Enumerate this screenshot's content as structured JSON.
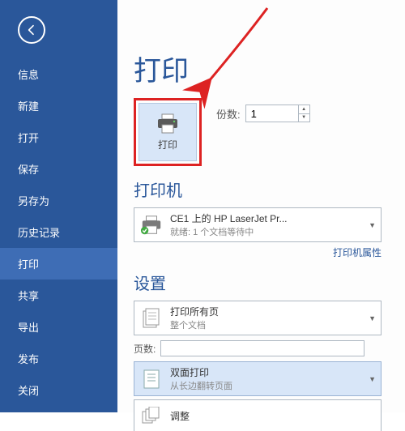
{
  "sidebar": {
    "items": [
      {
        "label": "信息"
      },
      {
        "label": "新建"
      },
      {
        "label": "打开"
      },
      {
        "label": "保存"
      },
      {
        "label": "另存为"
      },
      {
        "label": "历史记录"
      },
      {
        "label": "打印"
      },
      {
        "label": "共享"
      },
      {
        "label": "导出"
      },
      {
        "label": "发布"
      },
      {
        "label": "关闭"
      }
    ]
  },
  "page": {
    "title": "打印",
    "print_button": "打印",
    "copies_label": "份数:",
    "copies_value": "1"
  },
  "printer": {
    "heading": "打印机",
    "name": "CE1 上的 HP LaserJet Pr...",
    "status": "就绪: 1 个文档等待中",
    "props_link": "打印机属性"
  },
  "settings": {
    "heading": "设置",
    "scope_title": "打印所有页",
    "scope_sub": "整个文档",
    "pages_label": "页数:",
    "duplex_title": "双面打印",
    "duplex_sub": "从长边翻转页面",
    "collate_title": "调整"
  }
}
